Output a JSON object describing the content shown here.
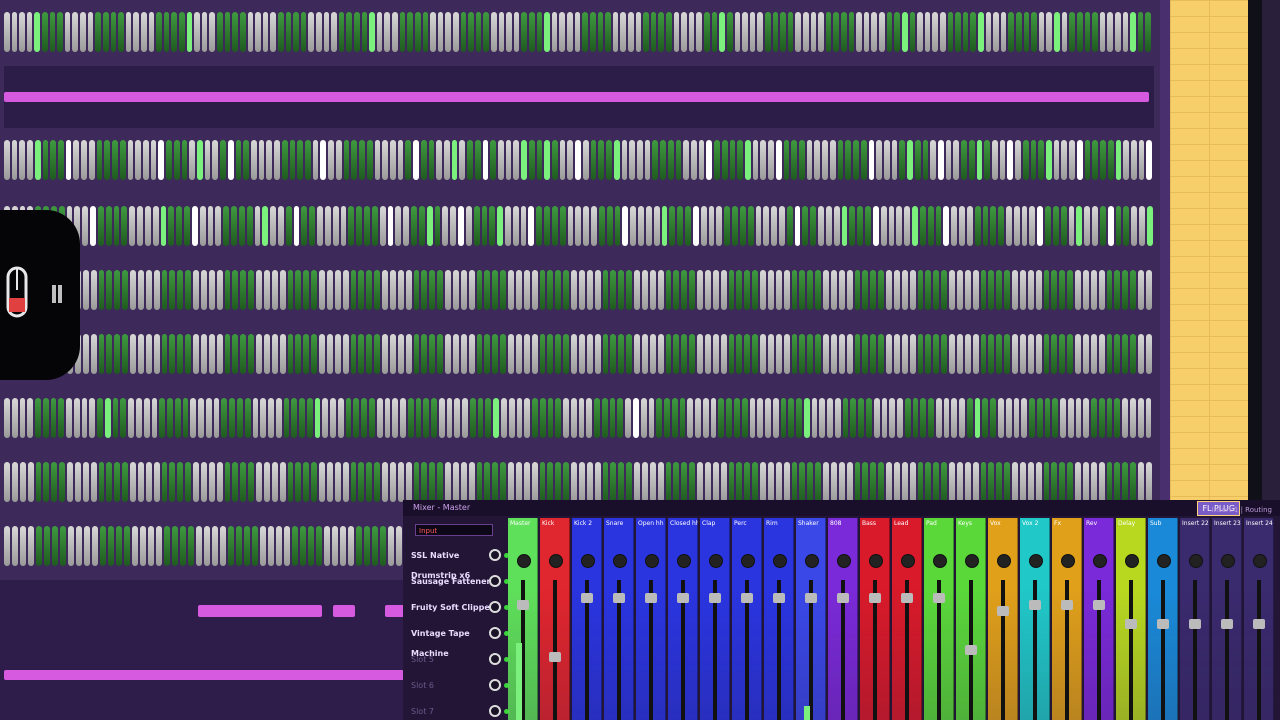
{
  "step_sequencer": {
    "rows": [
      {
        "pattern": "gggghggggggggggggggggggghggggggggggggggggggggggghgggggggggggggggggggggghgggggggggggggggggggggghggggggggggggggggggggggghggggggggghggggggggghggggggggghgg"
      },
      {
        "pattern": "gggghgggwgggggggggggwgggghgggwgggggggggggwgggggggggggwgggghgggwgggghgghgggwgggghgggggggggggwgggghgggwgggggggggggwgggghgggwgggghgggwgggghgggwgggghgggw"
      },
      {
        "pattern": "gggggggggggwgggggggghgggwgggggggghgggwgggggggggggwgggghgggwgggghgggwgggggggggggwgggghgggwggggggggggggwggggghgggwgggghgggwgggggggggggwgggghgggwggggh"
      },
      {
        "pattern": "gggggggggggggggggggggggggggggggggggggggggggggggggggggggggggggggggggggggggggggggggggggggggggggggggggggggggggggggggggggggggggggggggggggggggggggggggg"
      },
      {
        "pattern": "gggggggggggggggggggggggggggggggggggggggggggggggggggggggggggggggggggggggggggggggggggggggggggggggggggggggggggggggggggggggggggggggggggggggggggggggggg"
      },
      {
        "pattern": "ggggggggggggghgggggggggggggggggggggggggghgggggggggggggggggggggghgggggggggggggggggwggggggggggggggggggggghggggggggggggggggggggghgggggggggggggggggggggg"
      },
      {
        "pattern": "gggggggggggggggggggggggggggggggggggggggggggggggggggggggggggggggggggggggggggggggggggggggggggggggggggggggggggggggggggggggggggggggggggggggggggggggggg"
      },
      {
        "pattern": "gggggggggggggggggggggggggggggggggggggggggggggggggg"
      }
    ]
  },
  "mixer": {
    "title": "Mixer - Master",
    "logo": "FL PLUG",
    "mode_label": "Insert 1 | Routing",
    "search_text": "Input",
    "instruments": [
      {
        "label": "SSL Native Drumstrip x6",
        "dim": false
      },
      {
        "label": "Sausage Fattener",
        "dim": false
      },
      {
        "label": "Fruity Soft Clipper",
        "dim": false
      },
      {
        "label": "Vintage Tape Machine",
        "dim": false
      },
      {
        "label": "Slot 5",
        "dim": true
      },
      {
        "label": "Slot 6",
        "dim": true
      },
      {
        "label": "Slot 7",
        "dim": true
      }
    ],
    "channels": [
      {
        "name": "Master",
        "color": "#5fe05a",
        "width": 30,
        "fader": 0.85,
        "meter": 0.55
      },
      {
        "name": "Kick",
        "color": "#e0262e",
        "width": 30,
        "fader": 0.45
      },
      {
        "name": "Kick 2",
        "color": "#2a35e0",
        "width": 30,
        "fader": 0.9
      },
      {
        "name": "Snare",
        "color": "#2a35e0",
        "width": 30,
        "fader": 0.9
      },
      {
        "name": "Open hh",
        "color": "#2a35e0",
        "width": 30,
        "fader": 0.9
      },
      {
        "name": "Closed hh",
        "color": "#2a35e0",
        "width": 30,
        "fader": 0.9
      },
      {
        "name": "Clap",
        "color": "#2a35e0",
        "width": 30,
        "fader": 0.9
      },
      {
        "name": "Perc",
        "color": "#2a35e0",
        "width": 30,
        "fader": 0.9
      },
      {
        "name": "Rim",
        "color": "#2a35e0",
        "width": 30,
        "fader": 0.9
      },
      {
        "name": "Shaker",
        "color": "#3a48e8",
        "width": 30,
        "fader": 0.9,
        "meter": 0.1
      },
      {
        "name": "808",
        "color": "#7a2ad8",
        "width": 30,
        "fader": 0.9
      },
      {
        "name": "Bass",
        "color": "#d81a2a",
        "width": 30,
        "fader": 0.9
      },
      {
        "name": "Lead",
        "color": "#d81a2a",
        "width": 30,
        "fader": 0.9
      },
      {
        "name": "Pad",
        "color": "#5ad83a",
        "width": 30,
        "fader": 0.9
      },
      {
        "name": "Keys",
        "color": "#5ad83a",
        "width": 30,
        "fader": 0.5
      },
      {
        "name": "Vox",
        "color": "#e0a01a",
        "width": 30,
        "fader": 0.8
      },
      {
        "name": "Vox 2",
        "color": "#20c8c8",
        "width": 30,
        "fader": 0.85
      },
      {
        "name": "Fx",
        "color": "#e0a01a",
        "width": 30,
        "fader": 0.85
      },
      {
        "name": "Rev",
        "color": "#7a2ad8",
        "width": 30,
        "fader": 0.85
      },
      {
        "name": "Delay",
        "color": "#b8d820",
        "width": 30,
        "fader": 0.7
      },
      {
        "name": "Sub",
        "color": "#1a8ad8",
        "width": 30,
        "fader": 0.7
      },
      {
        "name": "Insert 22",
        "color": "#3a2a6e",
        "width": 30,
        "fader": 0.7
      },
      {
        "name": "Insert 23",
        "color": "#3a2a6e",
        "width": 30,
        "fader": 0.7
      },
      {
        "name": "Insert 24",
        "color": "#3a2a6e",
        "width": 30,
        "fader": 0.7
      }
    ]
  },
  "colors": {
    "background": "#3d2a5a",
    "playlist_clip": "#d65ae0",
    "step_on": "#2f7a30",
    "step_highlight": "#7cf07c",
    "right_panel": "#f6cf6a"
  }
}
